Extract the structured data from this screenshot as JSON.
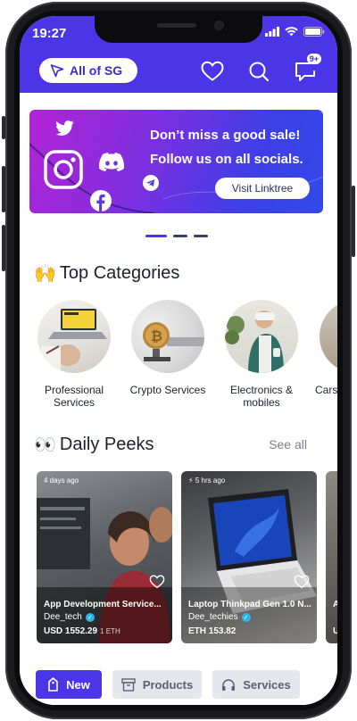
{
  "status": {
    "time": "19:27"
  },
  "header": {
    "location_label": "All of SG",
    "notification_count": "9+"
  },
  "banner": {
    "line1": "Don’t miss a good sale!",
    "line2": "Follow us on all socials.",
    "cta": "Visit Linktree",
    "icons": [
      "twitter-icon",
      "instagram-icon",
      "discord-icon",
      "telegram-icon",
      "facebook-icon"
    ]
  },
  "carousel": {
    "pages": 3,
    "active": 1
  },
  "categories": {
    "emoji": "🙌",
    "title": "Top Categories",
    "items": [
      {
        "label": "Professional Services"
      },
      {
        "label": "Crypto Services"
      },
      {
        "label": "Electronics & mobiles"
      },
      {
        "label": "Cars"
      }
    ]
  },
  "peeks": {
    "emoji": "👀",
    "title": "Daily Peeks",
    "see_all": "See all",
    "cards": [
      {
        "time_ago": "4 days ago",
        "title": "App Development Service...",
        "seller": "Dee_tech",
        "price": "USD 1552.29",
        "price_sub": "1 ETH"
      },
      {
        "time_ago": "5 hrs ago",
        "title": "Laptop Thinkpad Gen 1.0 N...",
        "seller": "Dee_techies",
        "price": "ETH 153.82",
        "price_sub": ""
      },
      {
        "time_ago": "",
        "title": "A",
        "seller": "",
        "price": "U",
        "price_sub": ""
      }
    ]
  },
  "tabs": [
    {
      "label": "New",
      "active": true
    },
    {
      "label": "Products",
      "active": false
    },
    {
      "label": "Services",
      "active": false
    }
  ],
  "colors": {
    "primary": "#4b35e6",
    "text": "#1d1f33",
    "muted": "#7b7e90",
    "tab_inactive": "#e6e7ec"
  }
}
